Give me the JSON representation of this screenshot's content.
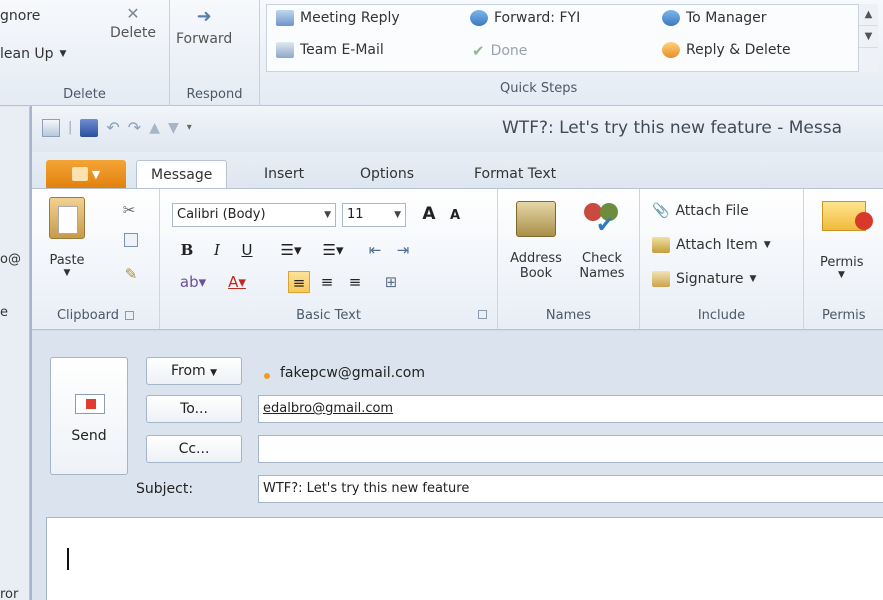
{
  "background_ribbon": {
    "delete_group": {
      "ignore": "gnore",
      "clean_up": "lean Up",
      "delete": "Delete",
      "label": "Delete"
    },
    "respond_group": {
      "forward": "Forward",
      "label": "Respond"
    },
    "quick_steps": {
      "label": "Quick Steps",
      "items": [
        "Meeting Reply",
        "Forward: FYI",
        "To Manager",
        "Team E-Mail",
        "Done",
        "Reply & Delete"
      ]
    },
    "left_strip": {
      "line1": "o@",
      "line2": "e",
      "line3": "ror"
    }
  },
  "message_window": {
    "title": "WTF?: Let's try this new feature  -  Messa",
    "tabs": [
      "Message",
      "Insert",
      "Options",
      "Format Text"
    ],
    "active_tab": "Message",
    "ribbon": {
      "clipboard": {
        "label": "Clipboard",
        "paste": "Paste"
      },
      "basic_text": {
        "label": "Basic Text",
        "font": "Calibri (Body)",
        "size": "11"
      },
      "names": {
        "label": "Names",
        "address_book_1": "Address",
        "address_book_2": "Book",
        "check_names_1": "Check",
        "check_names_2": "Names"
      },
      "include": {
        "label": "Include",
        "attach_file": "Attach File",
        "attach_item": "Attach Item",
        "signature": "Signature"
      },
      "permission": {
        "label": "Permis",
        "button": "Permis"
      }
    },
    "compose": {
      "send": "Send",
      "from_button": "From",
      "from_value": "fakepcw@gmail.com",
      "to_button": "To...",
      "to_value": "edalbro@gmail.com",
      "cc_button": "Cc...",
      "cc_value": "",
      "subject_label": "Subject:",
      "subject_value": "WTF?: Let's try this new feature"
    }
  },
  "colors": {
    "file_tab": "#e2810d",
    "accent_active": "#f8c758",
    "from_dot": "#f09b26"
  }
}
